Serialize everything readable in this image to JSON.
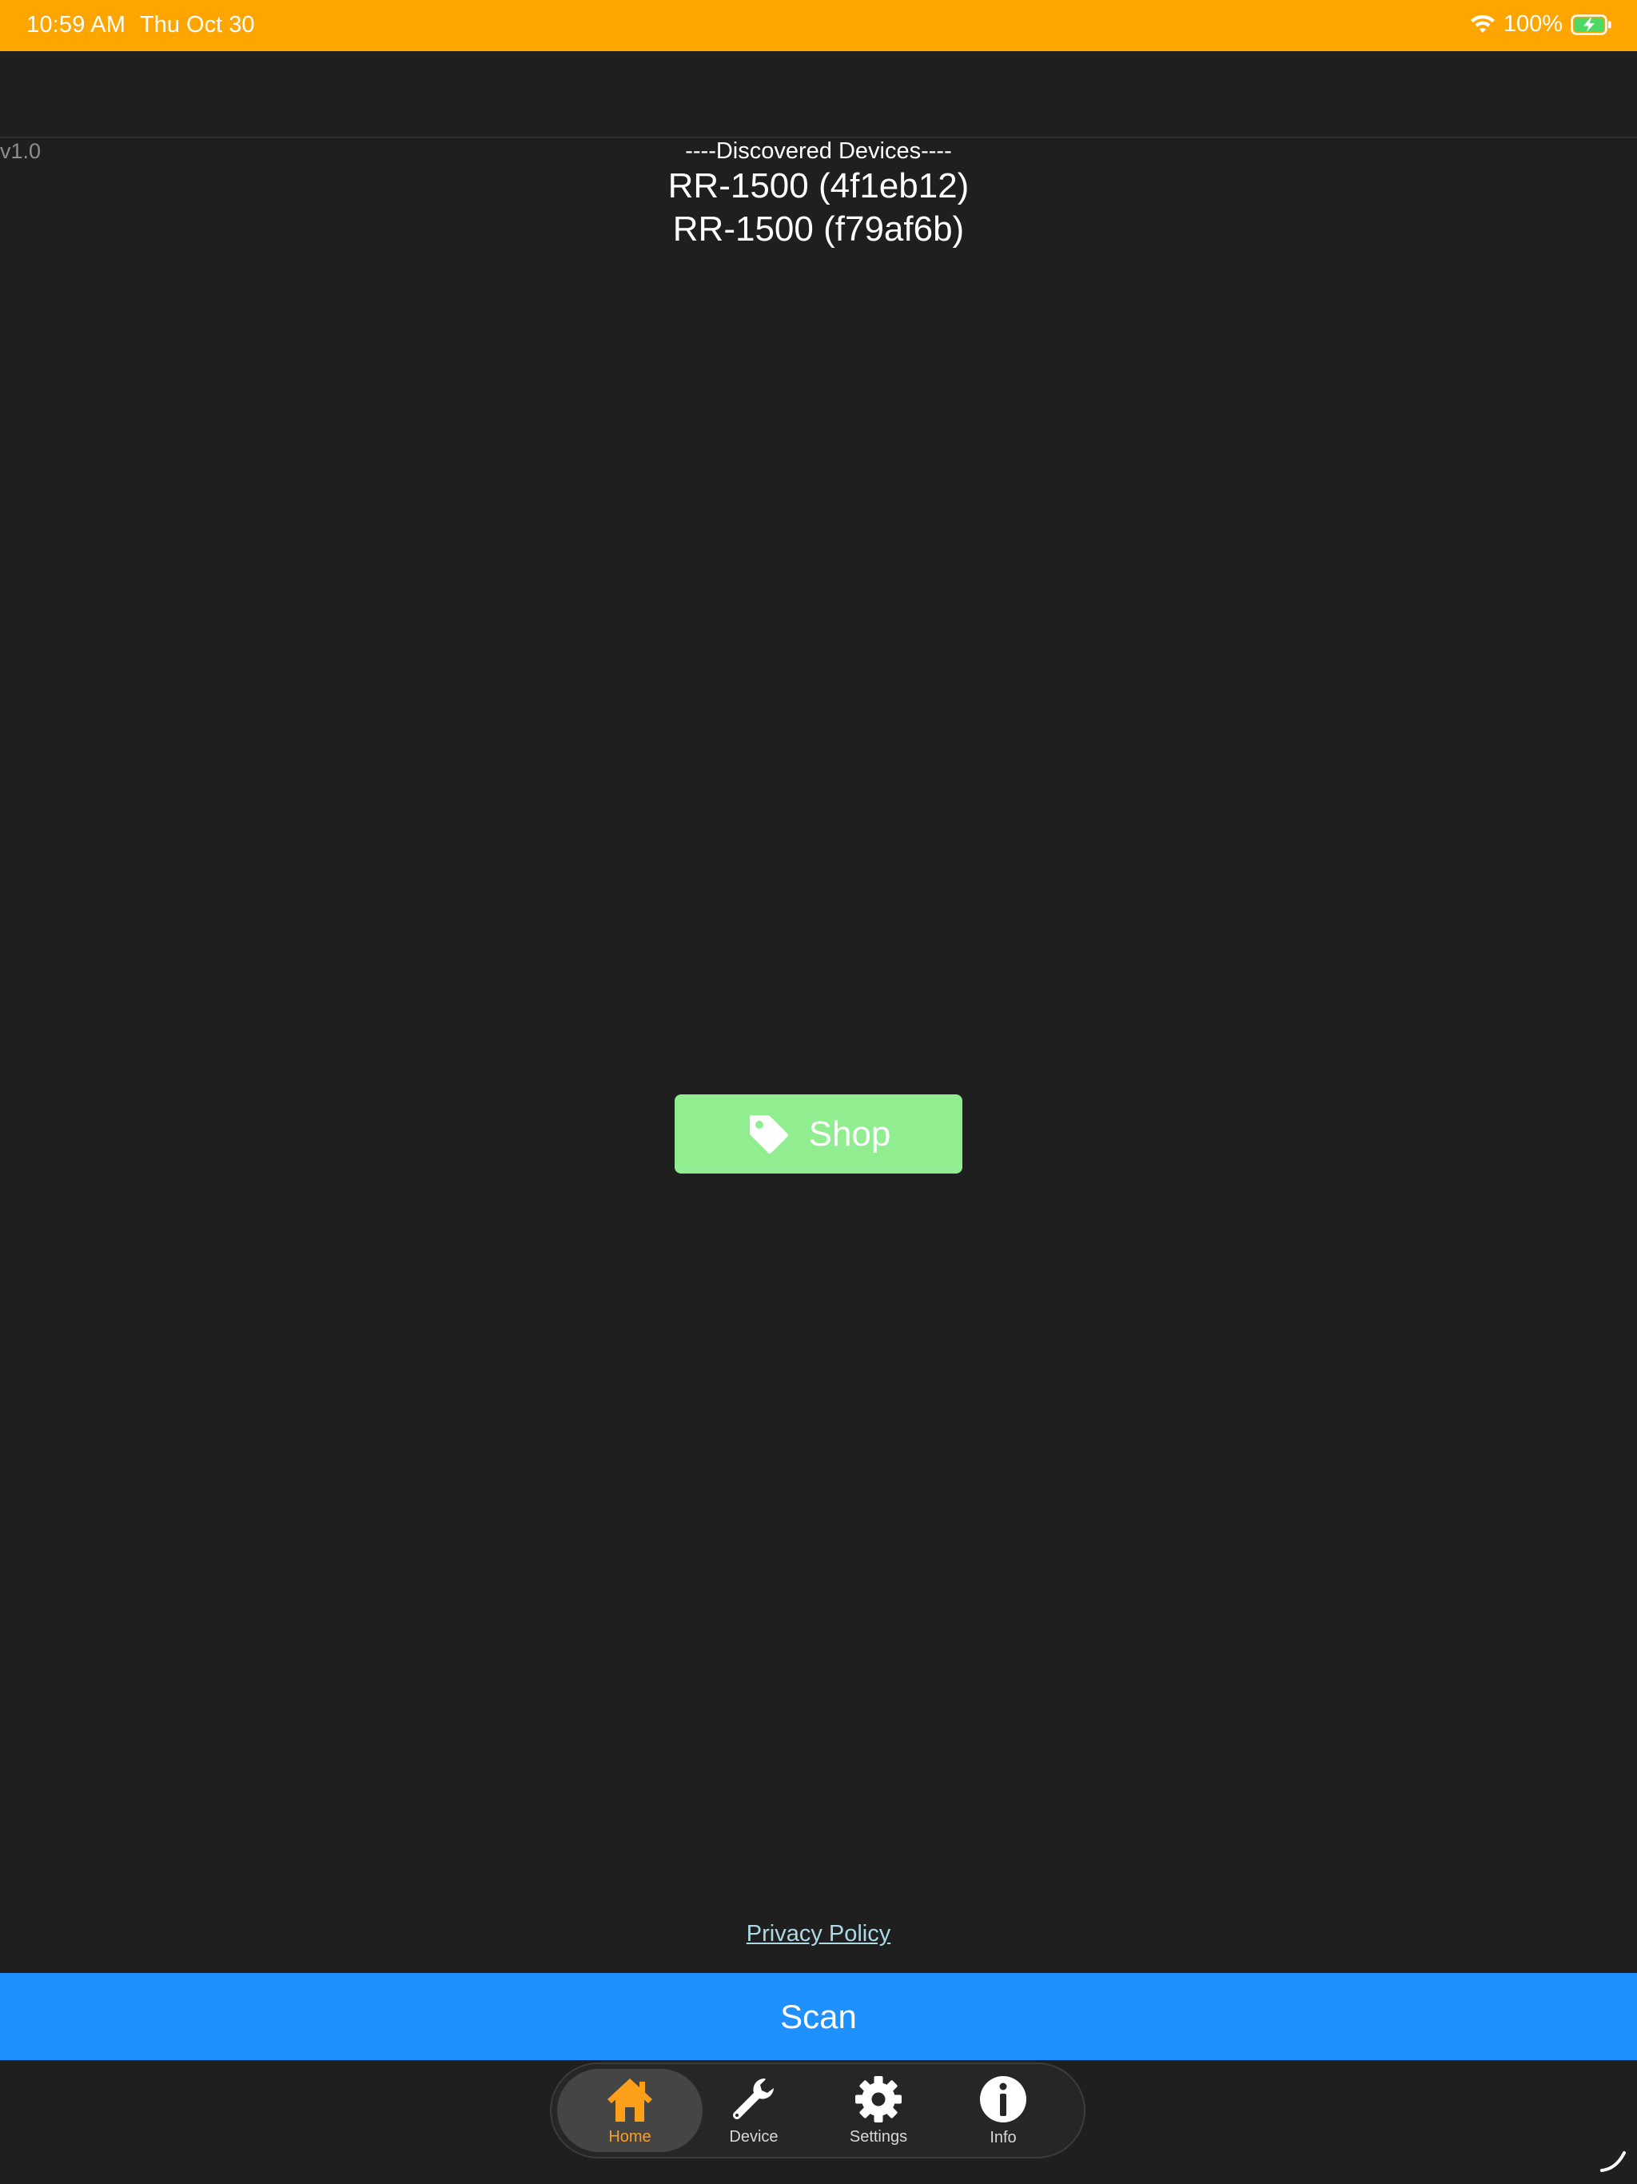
{
  "status_bar": {
    "time": "10:59 AM",
    "date": "Thu Oct 30",
    "battery": "100%",
    "icons": [
      "wifi-icon",
      "battery-charging-icon"
    ],
    "background": "#ffa500"
  },
  "version": "v1.0",
  "devices": {
    "header": "----Discovered Devices----",
    "items": [
      "RR-1500 (4f1eb12)",
      "RR-1500 (f79af6b)"
    ]
  },
  "shop_button": {
    "label": "Shop",
    "icon": "tag-icon",
    "color": "#90ee90"
  },
  "privacy_link": "Privacy Policy",
  "scan_button": {
    "label": "Scan",
    "color": "#1e90ff"
  },
  "tabs": [
    {
      "label": "Home",
      "icon": "home-icon",
      "active": true
    },
    {
      "label": "Device",
      "icon": "wrench-icon",
      "active": false
    },
    {
      "label": "Settings",
      "icon": "gear-icon",
      "active": false
    },
    {
      "label": "Info",
      "icon": "info-icon",
      "active": false
    }
  ],
  "colors": {
    "background": "#1f1f1f",
    "accent": "#ff9f1a"
  }
}
